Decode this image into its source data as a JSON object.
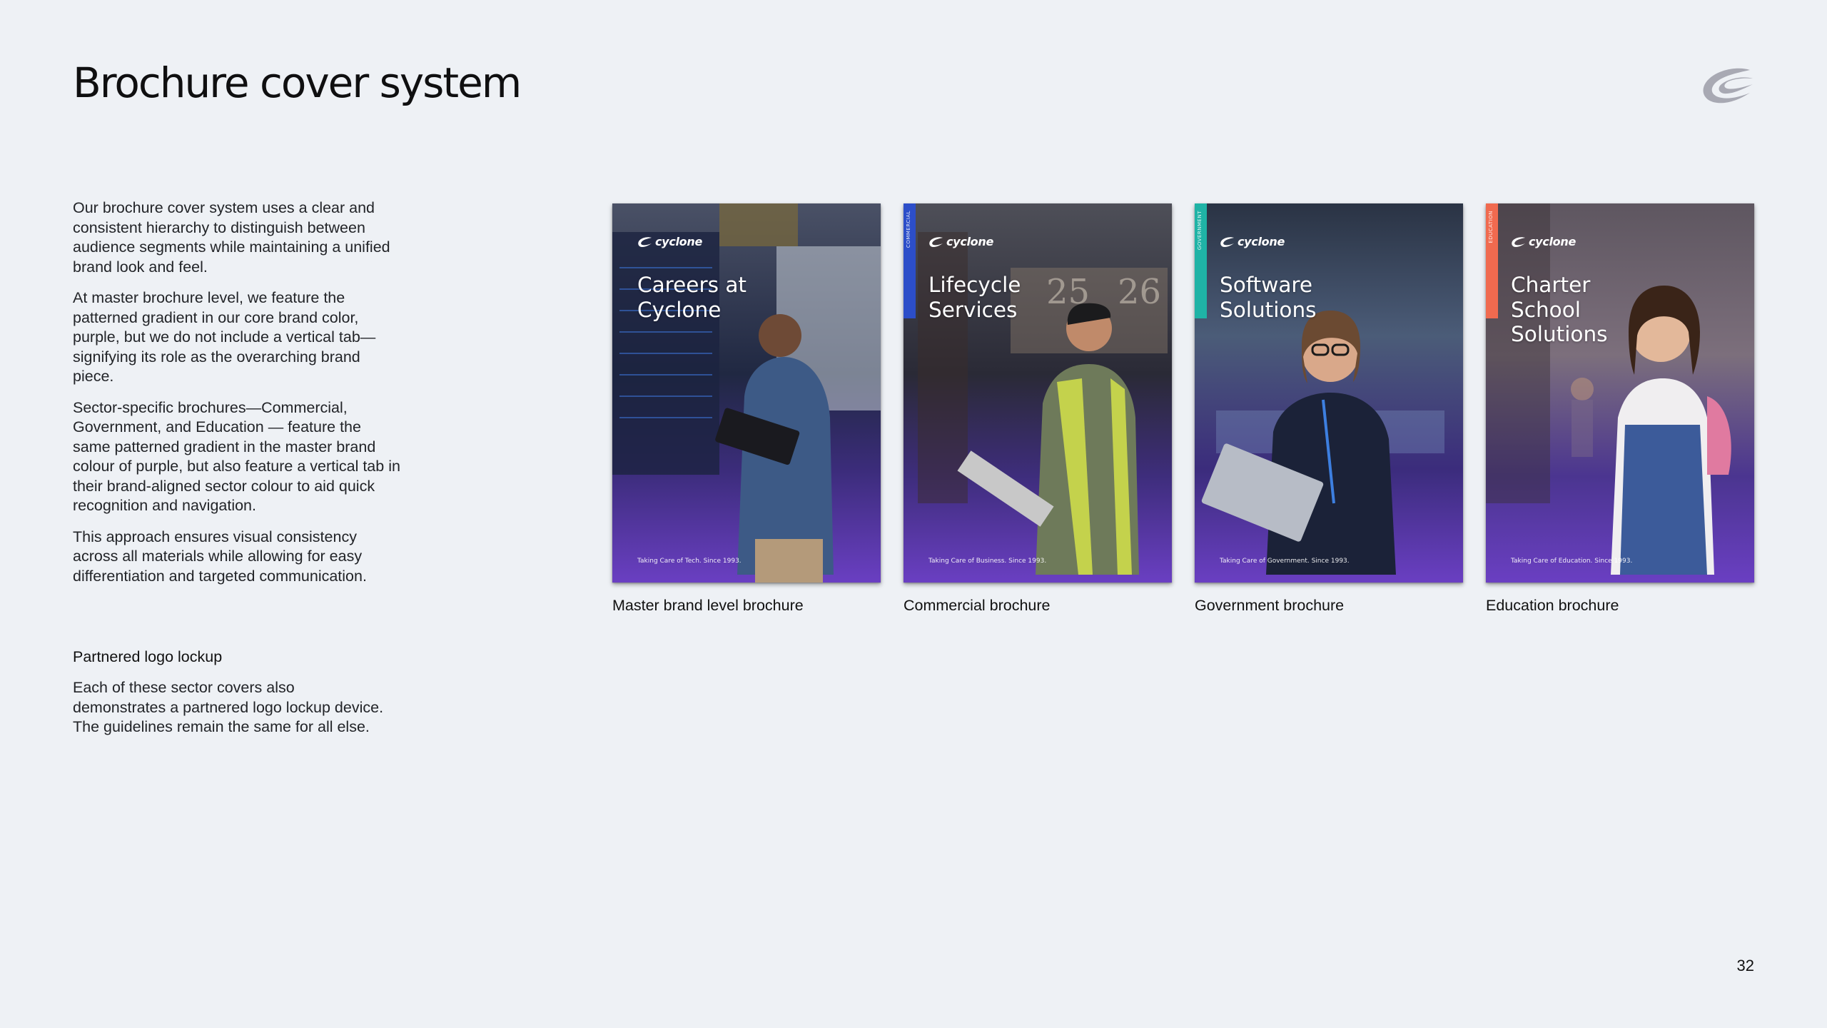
{
  "header": {
    "title": "Brochure cover system",
    "logo_icon": "cyclone-swirl-icon"
  },
  "intro": {
    "paragraphs": [
      "Our brochure cover system uses a clear and consistent hierarchy to distinguish between audience segments while maintaining a unified brand look and feel.",
      "At master brochure level, we feature the patterned gradient in our core brand color, purple, but we do not include a vertical tab—signifying its role as the overarching brand piece.",
      "Sector-specific brochures—Commercial, Government, and Education — feature the same patterned gradient in the master brand colour of purple, but also feature a vertical tab in their brand-aligned sector colour to aid quick recognition and navigation.",
      "This approach ensures visual consistency across all materials while allowing for easy differentiation and targeted communication."
    ]
  },
  "partnered": {
    "heading": "Partnered logo lockup",
    "body": "Each of these sector covers also demonstrates a partnered logo lockup device. The guidelines remain the same for all else."
  },
  "brochures": [
    {
      "logo_text": "cyclone",
      "title_lines": [
        "Careers at",
        "Cyclone"
      ],
      "tagline": "Taking Care of Tech. Since 1993.",
      "caption": "Master brand level brochure",
      "tab": null,
      "photo_subject": "man-with-laptop-in-server-room",
      "photo_top_color": "#3f4a63"
    },
    {
      "logo_text": "cyclone",
      "title_lines": [
        "Lifecycle",
        "Services"
      ],
      "tagline": "Taking Care of Business. Since 1993.",
      "caption": "Commercial brochure",
      "tab": {
        "label": "COMMERCIAL",
        "color": "#2c4ec9"
      },
      "photo_subject": "warehouse-worker-with-clipboard",
      "photo_top_color": "#4a4d57"
    },
    {
      "logo_text": "cyclone",
      "title_lines": [
        "Software",
        "Solutions"
      ],
      "tagline": "Taking Care of Government. Since 1993.",
      "caption": "Government brochure",
      "tab": {
        "label": "GOVERNMENT",
        "color": "#1fb3a6"
      },
      "photo_subject": "woman-with-laptop-in-office",
      "photo_top_color": "#2c3646"
    },
    {
      "logo_text": "cyclone",
      "title_lines": [
        "Charter",
        "School",
        "Solutions"
      ],
      "tagline": "Taking Care of Education. Since 1993.",
      "caption": "Education brochure",
      "tab": {
        "label": "EDUCATION",
        "color": "#f06a4f"
      },
      "photo_subject": "girl-with-backpack-in-school-hallway",
      "photo_top_color": "#5d5560"
    }
  ],
  "colors": {
    "background": "#eef1f5",
    "brand_purple": "#5b35b0",
    "text": "#111111"
  },
  "page_number": "32"
}
